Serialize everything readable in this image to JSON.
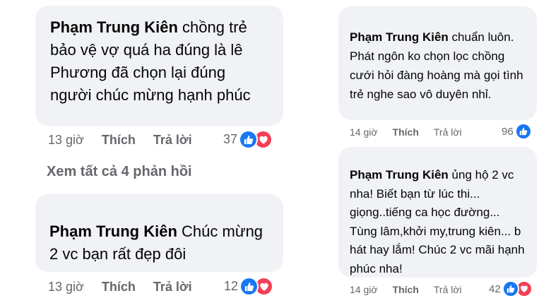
{
  "comments": [
    {
      "author": "Phạm Trung Kiên",
      "text": "chồng trẻ bảo vệ vợ quá ha đúng là lê Phương đã chọn lại đúng người chúc mừng hạnh phúc",
      "time": "13 giờ",
      "like_label": "Thích",
      "reply_label": "Trả lời",
      "reaction_count": "37",
      "reactions": [
        "like-icon",
        "love-icon"
      ]
    },
    {
      "author": "Phạm Trung Kiên",
      "text": "Chúc mừng 2 vc bạn rất đẹp đôi",
      "time": "13 giờ",
      "like_label": "Thích",
      "reply_label": "Trả lời",
      "reaction_count": "12",
      "reactions": [
        "like-icon",
        "love-icon"
      ]
    },
    {
      "author": "Phạm Trung Kiên",
      "text": "chuẩn luôn. Phát ngôn ko chọn lọc chồng cưới hỏi đàng hoàng mà gọi tình trẻ nghe sao vô duyên nhỉ.",
      "time": "14 giờ",
      "like_label": "Thích",
      "reply_label": "Trả lời",
      "reaction_count": "96",
      "reactions": [
        "like-icon"
      ]
    },
    {
      "author": "Phạm Trung Kiên",
      "text": "ủng hộ 2 vc nha! Biết bạn từ lúc thi... giọng..tiếng ca học đường... Tùng lâm,khởi my,trung kiên... b hát hay lắm! Chúc 2 vc mãi hạnh phúc nha!",
      "time": "14 giờ",
      "like_label": "Thích",
      "reply_label": "Trả lời",
      "reaction_count": "42",
      "reactions": [
        "like-icon",
        "love-icon"
      ]
    }
  ],
  "see_all_replies": "Xem tất cả 4 phản hồi",
  "colors": {
    "bubble": "#f0f2f5",
    "meta": "#65676b",
    "like": "#1877f2",
    "love": "#f33e58"
  }
}
